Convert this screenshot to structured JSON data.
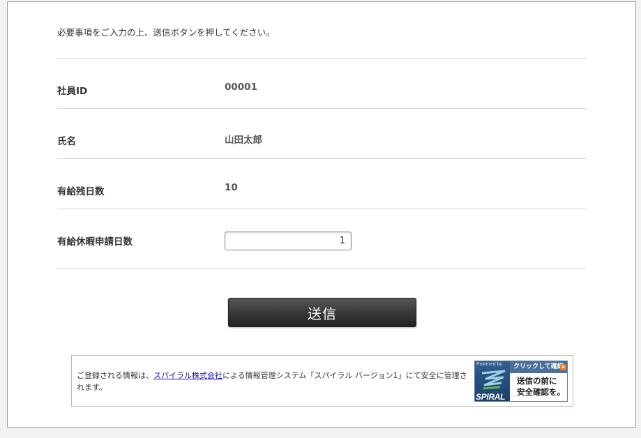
{
  "form": {
    "intro": "必要事項をご入力の上、送信ボタンを押してください。",
    "fields": [
      {
        "label": "社員ID",
        "value": "00001"
      },
      {
        "label": "氏名",
        "value": "山田太郎"
      },
      {
        "label": "有給残日数",
        "value": "10"
      },
      {
        "label": "有給休暇申請日数",
        "input_value": "1"
      }
    ],
    "submit_label": "送信"
  },
  "notice": {
    "text_before": "ご登録される情報は、",
    "link_text": "スパイラル株式会社",
    "text_after": "による情報管理システム「スパイラル バージョン1」にて安全に管理されます。"
  },
  "badge": {
    "powered_by": "Powered by",
    "brand": "SPIRAL",
    "click_label": "クリックして確認",
    "message_line1": "送信の前に",
    "message_line2": "安全確認を。",
    "colors": {
      "panel": "#1b3d66",
      "header": "#4a6f99",
      "play": "#f08020"
    }
  }
}
